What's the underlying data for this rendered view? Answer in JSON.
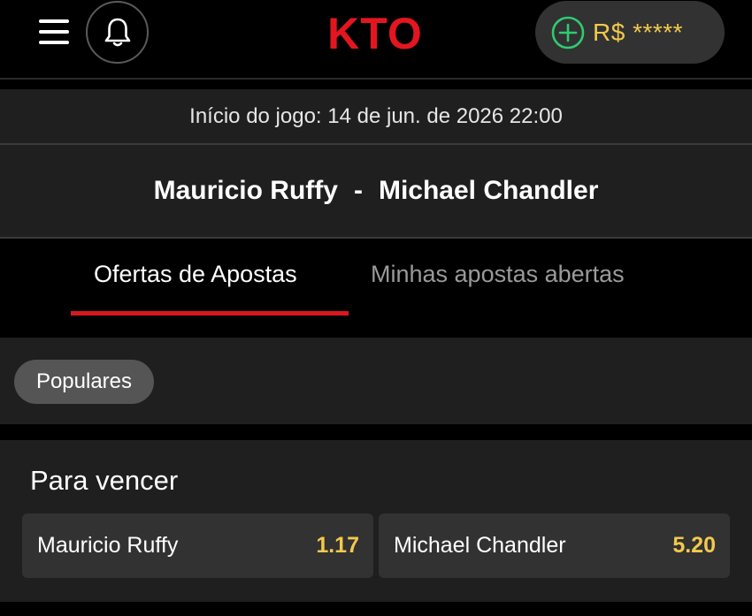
{
  "header": {
    "logo_text": "KTO",
    "balance_label": "R$ *****",
    "colors": {
      "brand": "#e3161f",
      "balance": "#f2c94c",
      "plus": "#2ecc71"
    }
  },
  "event": {
    "start_label": "Início do jogo: 14 de jun. de 2026 22:00",
    "home": "Mauricio Ruffy",
    "separator": "-",
    "away": "Michael Chandler"
  },
  "tabs": [
    {
      "label": "Ofertas de Apostas",
      "active": true
    },
    {
      "label": "Minhas apostas abertas",
      "active": false
    }
  ],
  "filters": {
    "selected": "Populares"
  },
  "market": {
    "title": "Para vencer",
    "outcomes": [
      {
        "name": "Mauricio Ruffy",
        "odds": "1.17"
      },
      {
        "name": "Michael Chandler",
        "odds": "5.20"
      }
    ]
  },
  "icons": [
    "menu-icon",
    "bell-icon",
    "plus-circle-icon"
  ],
  "colors": {
    "tab_active_underline": "#d71920",
    "panel": "#1f1f1f",
    "button": "#323232"
  }
}
